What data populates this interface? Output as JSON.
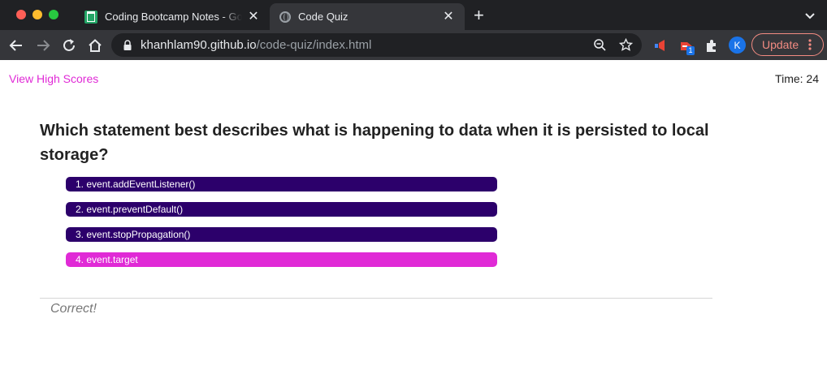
{
  "browser": {
    "tabs": [
      {
        "title": "Coding Bootcamp Notes - Google Sheets",
        "favicon": "sheets-icon",
        "active": false
      },
      {
        "title": "Code Quiz",
        "favicon": "globe-icon",
        "active": true
      }
    ],
    "close_glyph": "✕",
    "new_tab_glyph": "+",
    "url_host": "khanhlam90.github.io",
    "url_path": "/code-quiz/index.html",
    "extension_badge": "1",
    "avatar_initial": "K",
    "update_label": "Update",
    "colors": {
      "tab_bar": "#202124",
      "toolbar": "#35363a",
      "update": "#f28b82",
      "avatar": "#1a73e8"
    }
  },
  "page": {
    "high_scores_link": "View High Scores",
    "timer": "Time: 24",
    "question": "Which statement best describes what is happening to data when it is persisted to local storage?",
    "answers": [
      "1. event.addEventListener()",
      "2. event.preventDefault()",
      "3. event.stopPropagation()",
      "4. event.target"
    ],
    "selected_answer_index": 3,
    "feedback": "Correct!",
    "colors": {
      "link": "#e02ad6",
      "answer_bg": "#2c006b",
      "answer_selected_bg": "#e02ad6"
    }
  }
}
